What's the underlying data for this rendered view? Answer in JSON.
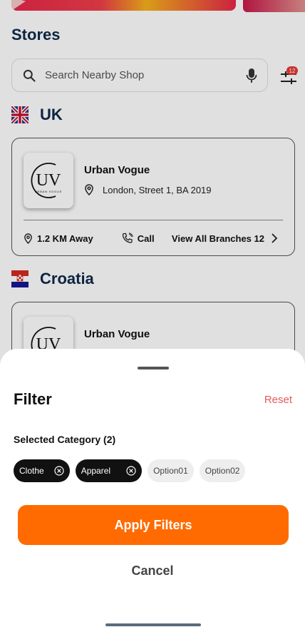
{
  "stores": {
    "title": "Stores",
    "search_placeholder": "Search Nearby Shop",
    "filter_badge": "12",
    "groups": [
      {
        "country": "UK",
        "store": {
          "name": "Urban Vogue",
          "address": "London, Street 1, BA 2019",
          "distance": "1.2 KM Away",
          "call": "Call",
          "branches": "View All Branches 12",
          "logo_text": "URBAN VOGUE",
          "logo_initials": "UV"
        }
      },
      {
        "country": "Croatia",
        "store": {
          "name": "Urban Vogue",
          "logo_text": "URBAN VOGUE",
          "logo_initials": "UV"
        }
      }
    ]
  },
  "filter": {
    "title": "Filter",
    "reset": "Reset",
    "category_title": "Selected Category (2)",
    "selected": [
      "Clothe",
      "Apparel"
    ],
    "options": [
      "Option01",
      "Option02"
    ],
    "apply": "Apply Filters",
    "cancel": "Cancel"
  },
  "colors": {
    "accent": "#ff6b00",
    "reset": "#e8585a",
    "heading": "#0f2a4a"
  }
}
